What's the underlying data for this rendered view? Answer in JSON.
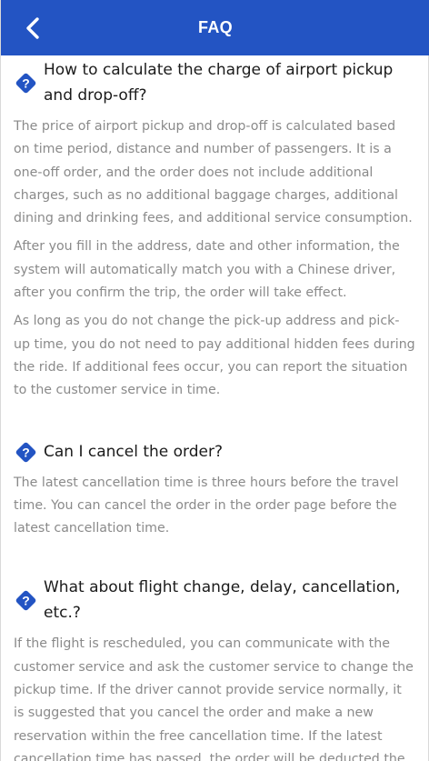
{
  "header": {
    "title": "FAQ",
    "back_icon": "chevron-left-icon"
  },
  "colors": {
    "header_bg": "#2354c3",
    "icon_blue": "#2354c3",
    "question_text": "#1b1b1b",
    "answer_text": "#8a8a8a"
  },
  "faqs": [
    {
      "icon": "question-diamond-icon",
      "question": "How to calculate the charge of airport pickup and drop-off?",
      "answers": [
        "The price of airport pickup and drop-off is calculated based on time period, distance and number of passengers. It is a one-off order, and the order does not include additional charges, such as no additional baggage charges, additional dining and drinking fees, and additional service consumption.",
        "After you fill in the address, date and other information, the system will automatically match you with a Chinese driver, after you confirm the trip, the order will take effect.",
        "As long as you do not change the pick-up address and pick-up time, you do not need to pay additional hidden fees during the ride. If additional fees occur, you can report the situation to the customer service in time."
      ]
    },
    {
      "icon": "question-diamond-icon",
      "question": "Can I cancel the order?",
      "answers": [
        "The latest cancellation time is three hours before the travel time. You can cancel the order in the order page before the latest cancellation time."
      ]
    },
    {
      "icon": "question-diamond-icon",
      "question": "What about flight change, delay, cancellation, etc.?",
      "answers": [
        "If the flight is rescheduled, you can communicate with the customer service and ask the customer service to change the pickup time. If the driver cannot provide service normally, it is suggested that you cancel the order and make a new reservation within the free cancellation time. If the latest cancellation time has passed, the order will be deducted the"
      ]
    }
  ]
}
